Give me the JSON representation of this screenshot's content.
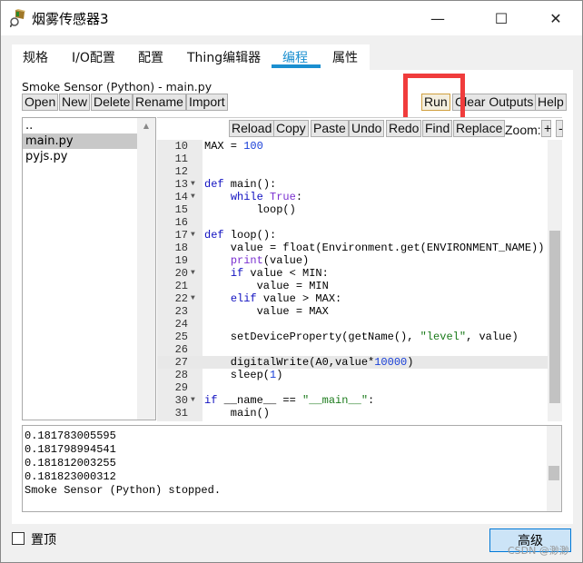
{
  "window": {
    "title": "烟雾传感器3",
    "minimize": "—",
    "maximize": "☐",
    "close": "✕",
    "icon": "thing-editor-app-icon"
  },
  "tabs": [
    {
      "label": "规格"
    },
    {
      "label": "I/O配置"
    },
    {
      "label": "配置"
    },
    {
      "label": "Thing编辑器"
    },
    {
      "label": "编程",
      "active": true
    },
    {
      "label": "属性"
    }
  ],
  "program": {
    "file_label": "Smoke Sensor (Python) - main.py",
    "file_buttons": [
      "Open",
      "New",
      "Delete",
      "Rename",
      "Import"
    ],
    "run_buttons": [
      "Run",
      "Clear Outputs",
      "Help"
    ],
    "editor_buttons": [
      "Reload",
      "Copy",
      "Paste",
      "Undo",
      "Redo",
      "Find",
      "Replace"
    ],
    "zoom_label": "Zoom:",
    "zoom_in": "+",
    "zoom_out": "-",
    "files": [
      "..",
      "main.py",
      "pyjs.py"
    ],
    "selected_file": "main.py",
    "current_line": 27,
    "code": [
      {
        "n": "10",
        "t": [
          [
            "MAX = ",
            ""
          ],
          [
            "100",
            "num"
          ]
        ]
      },
      {
        "n": "11",
        "t": []
      },
      {
        "n": "12",
        "t": []
      },
      {
        "n": "13",
        "f": true,
        "t": [
          [
            "def",
            "kw"
          ],
          [
            " main():",
            ""
          ]
        ]
      },
      {
        "n": "14",
        "f": true,
        "t": [
          [
            "    ",
            ""
          ],
          [
            "while",
            "kw"
          ],
          [
            " ",
            ""
          ],
          [
            "True",
            "bi"
          ],
          [
            ":",
            ""
          ]
        ]
      },
      {
        "n": "15",
        "t": [
          [
            "        loop()",
            ""
          ]
        ]
      },
      {
        "n": "16",
        "t": []
      },
      {
        "n": "17",
        "f": true,
        "t": [
          [
            "def",
            "kw"
          ],
          [
            " loop():",
            ""
          ]
        ]
      },
      {
        "n": "18",
        "t": [
          [
            "    value = float(Environment.get(ENVIRONMENT_NAME))",
            ""
          ]
        ]
      },
      {
        "n": "19",
        "t": [
          [
            "    ",
            ""
          ],
          [
            "print",
            "bi"
          ],
          [
            "(value)",
            ""
          ]
        ]
      },
      {
        "n": "20",
        "f": true,
        "t": [
          [
            "    ",
            ""
          ],
          [
            "if",
            "kw"
          ],
          [
            " value < MIN:",
            ""
          ]
        ]
      },
      {
        "n": "21",
        "t": [
          [
            "        value = MIN",
            ""
          ]
        ]
      },
      {
        "n": "22",
        "f": true,
        "t": [
          [
            "    ",
            ""
          ],
          [
            "elif",
            "kw"
          ],
          [
            " value > MAX:",
            ""
          ]
        ]
      },
      {
        "n": "23",
        "t": [
          [
            "        value = MAX",
            ""
          ]
        ]
      },
      {
        "n": "24",
        "t": []
      },
      {
        "n": "25",
        "t": [
          [
            "    setDeviceProperty(getName(), ",
            ""
          ],
          [
            "\"level\"",
            "str"
          ],
          [
            ", value)",
            ""
          ]
        ]
      },
      {
        "n": "26",
        "t": []
      },
      {
        "n": "27",
        "t": [
          [
            "    digitalWrite(A0,value*",
            ""
          ],
          [
            "10000",
            "num"
          ],
          [
            ")",
            ""
          ]
        ]
      },
      {
        "n": "28",
        "t": [
          [
            "    sleep(",
            ""
          ],
          [
            "1",
            "num"
          ],
          [
            ")",
            ""
          ]
        ]
      },
      {
        "n": "29",
        "t": []
      },
      {
        "n": "30",
        "f": true,
        "t": [
          [
            "if",
            "kw"
          ],
          [
            " __name__ == ",
            ""
          ],
          [
            "\"__main__\"",
            "str"
          ],
          [
            ":",
            ""
          ]
        ]
      },
      {
        "n": "31",
        "t": [
          [
            "    main()",
            ""
          ]
        ]
      }
    ],
    "output": [
      "0.181783005595",
      "0.181798994541",
      "0.181812003255",
      "0.181823000312",
      "Smoke Sensor (Python) stopped."
    ]
  },
  "footer": {
    "always_on_top": "置顶",
    "always_on_top_checked": false,
    "advanced": "高级"
  },
  "watermark": "CSDN @渺渺",
  "colors": {
    "accent": "#1a8fd0",
    "highlight_box": "#f03c3c",
    "keyword": "#1010c0",
    "string": "#1a7a1a",
    "number": "#1a40d8"
  }
}
